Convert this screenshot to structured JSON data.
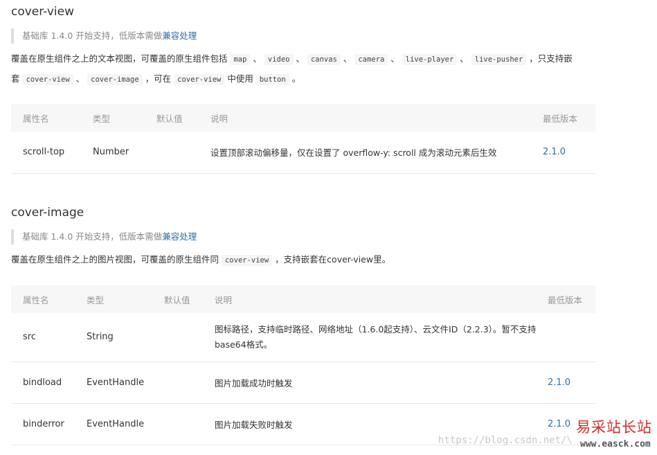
{
  "section1": {
    "title": "cover-view",
    "note_prefix": "基础库 1.4.0 开始支持，低版本需做",
    "note_link": "兼容处理",
    "desc": {
      "t1": "覆盖在原生组件之上的文本视图，可覆盖的原生组件包括 ",
      "c1": "map",
      "s1": " 、 ",
      "c2": "video",
      "s2": " 、 ",
      "c3": "canvas",
      "s3": " 、 ",
      "c4": "camera",
      "s4": " 、 ",
      "c5": "live-player",
      "s5": " 、 ",
      "c6": "live-pusher",
      "t2": " ，只支持嵌套 ",
      "c7": "cover-view",
      "s6": " 、 ",
      "c8": "cover-image",
      "t3": " ，可在 ",
      "c9": "cover-view",
      "t4": " 中使用 ",
      "c10": "button",
      "t5": " 。"
    },
    "table": {
      "headers": [
        "属性名",
        "类型",
        "默认值",
        "说明",
        "最低版本"
      ],
      "rows": [
        [
          "scroll-top",
          "Number",
          "",
          "设置顶部滚动偏移量，仅在设置了 overflow-y: scroll 成为滚动元素后生效",
          "2.1.0"
        ]
      ]
    }
  },
  "section2": {
    "title": "cover-image",
    "note_prefix": "基础库 1.4.0 开始支持，低版本需做",
    "note_link": "兼容处理",
    "desc": {
      "t1": "覆盖在原生组件之上的图片视图，可覆盖的原生组件同 ",
      "c1": "cover-view",
      "t2": " ，支持嵌套在cover-view里。"
    },
    "table": {
      "headers": [
        "属性名",
        "类型",
        "默认值",
        "说明",
        "最低版本"
      ],
      "rows": [
        [
          "src",
          "String",
          "",
          "图标路径，支持临时路径、网络地址（1.6.0起支持）、云文件ID（2.2.3）。暂不支持base64格式。",
          ""
        ],
        [
          "bindload",
          "EventHandle",
          "",
          "图片加载成功时触发",
          "2.1.0"
        ],
        [
          "binderror",
          "EventHandle",
          "",
          "图片加载失败时触发",
          "2.1.0"
        ]
      ]
    }
  },
  "watermark": "https://blog.csdn.net/\\",
  "logo": {
    "text": "易采站长站",
    "url": "www.easck.com"
  }
}
